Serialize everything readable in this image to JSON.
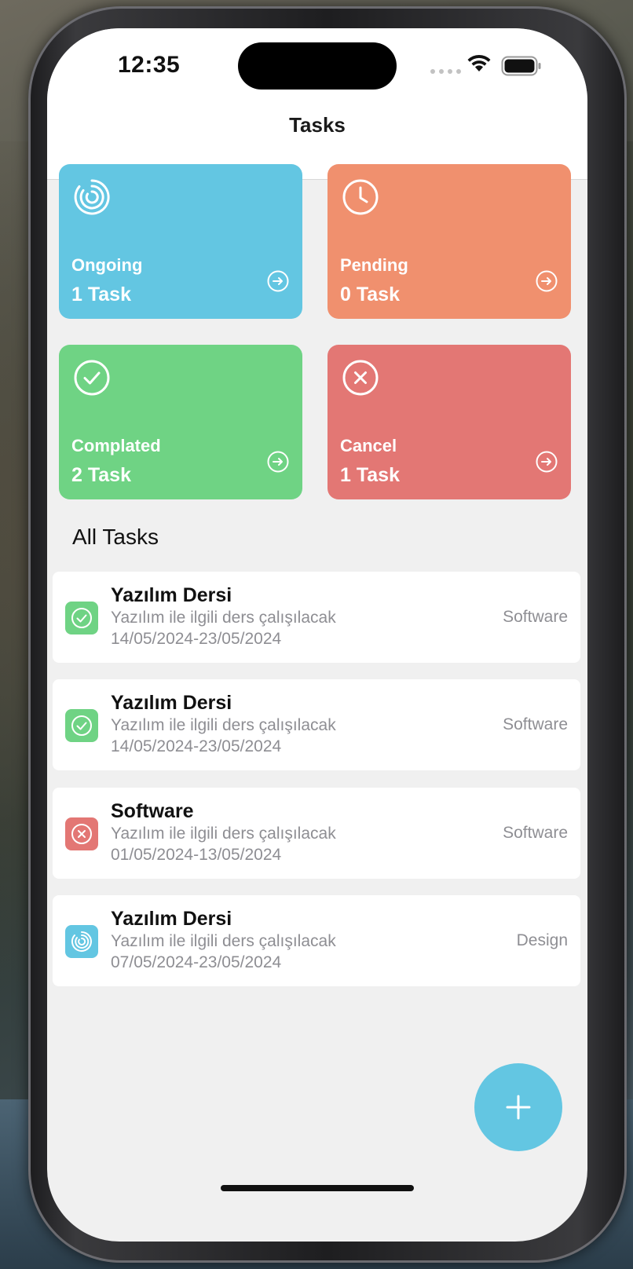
{
  "status_bar": {
    "time": "12:35"
  },
  "nav": {
    "title": "Tasks"
  },
  "colors": {
    "ongoing": "#63c6e2",
    "pending": "#f0906e",
    "completed": "#6fd384",
    "cancel": "#e37774"
  },
  "cards": [
    {
      "title": "Ongoing",
      "count": "1 Task",
      "icon": "progress-ring-icon"
    },
    {
      "title": "Pending",
      "count": "0 Task",
      "icon": "clock-icon"
    },
    {
      "title": "Complated",
      "count": "2 Task",
      "icon": "check-circle-icon"
    },
    {
      "title": "Cancel",
      "count": "1 Task",
      "icon": "x-circle-icon"
    }
  ],
  "section": {
    "title": "All Tasks"
  },
  "tasks": [
    {
      "title": "Yazılım Dersi",
      "description": "Yazılım ile ilgili ders çalışılacak",
      "dates": "14/05/2024-23/05/2024",
      "category": "Software",
      "status": "completed"
    },
    {
      "title": "Yazılım Dersi",
      "description": "Yazılım ile ilgili ders çalışılacak",
      "dates": "14/05/2024-23/05/2024",
      "category": "Software",
      "status": "completed"
    },
    {
      "title": "Software",
      "description": "Yazılım ile ilgili ders çalışılacak",
      "dates": "01/05/2024-13/05/2024",
      "category": "Software",
      "status": "cancel"
    },
    {
      "title": "Yazılım Dersi",
      "description": "Yazılım ile ilgili ders çalışılacak",
      "dates": "07/05/2024-23/05/2024",
      "category": "Design",
      "status": "ongoing"
    }
  ],
  "fab": {
    "icon": "plus-icon"
  }
}
